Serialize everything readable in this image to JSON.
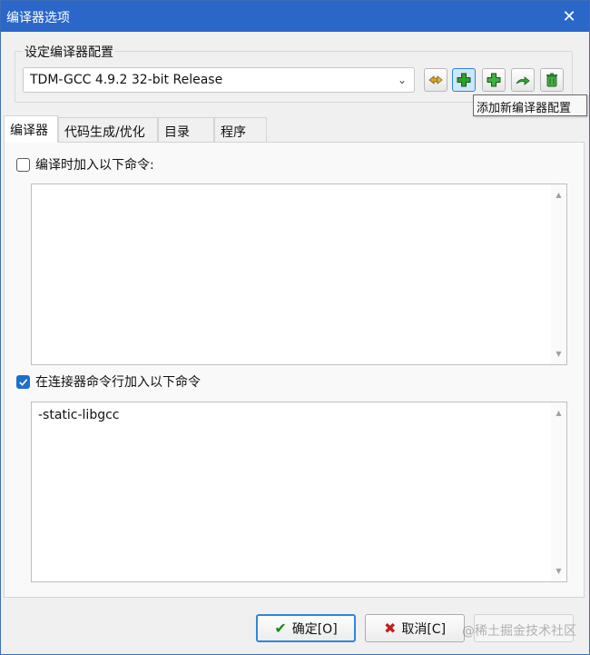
{
  "window": {
    "title": "编译器选项"
  },
  "config": {
    "group_label": "设定编译器配置",
    "selected_profile": "TDM-GCC 4.9.2 32-bit Release",
    "tooltip": "添加新编译器配置"
  },
  "toolbar": {
    "icons": [
      "rename-profile-icon",
      "add-blank-profile-icon",
      "add-copy-profile-icon",
      "rename-arrow-icon",
      "delete-profile-icon"
    ]
  },
  "tabs": [
    {
      "label": "编译器"
    },
    {
      "label": "代码生成/优化"
    },
    {
      "label": "目录"
    },
    {
      "label": "程序"
    }
  ],
  "compiler_cmd": {
    "checkbox_label": "编译时加入以下命令:",
    "checked": false,
    "value": ""
  },
  "linker_cmd": {
    "checkbox_label": "在连接器命令行加入以下命令",
    "checked": true,
    "value": "-static-libgcc"
  },
  "buttons": {
    "ok": "确定[O]",
    "cancel": "取消[C]"
  },
  "watermark": "@稀土掘金技术社区",
  "colors": {
    "titlebar": "#2a67c8",
    "accent": "#1f6fc9",
    "ok_icon": "#1a8a1a",
    "cancel_icon": "#c81e1e",
    "plus_icon": "#2f9e2f"
  }
}
